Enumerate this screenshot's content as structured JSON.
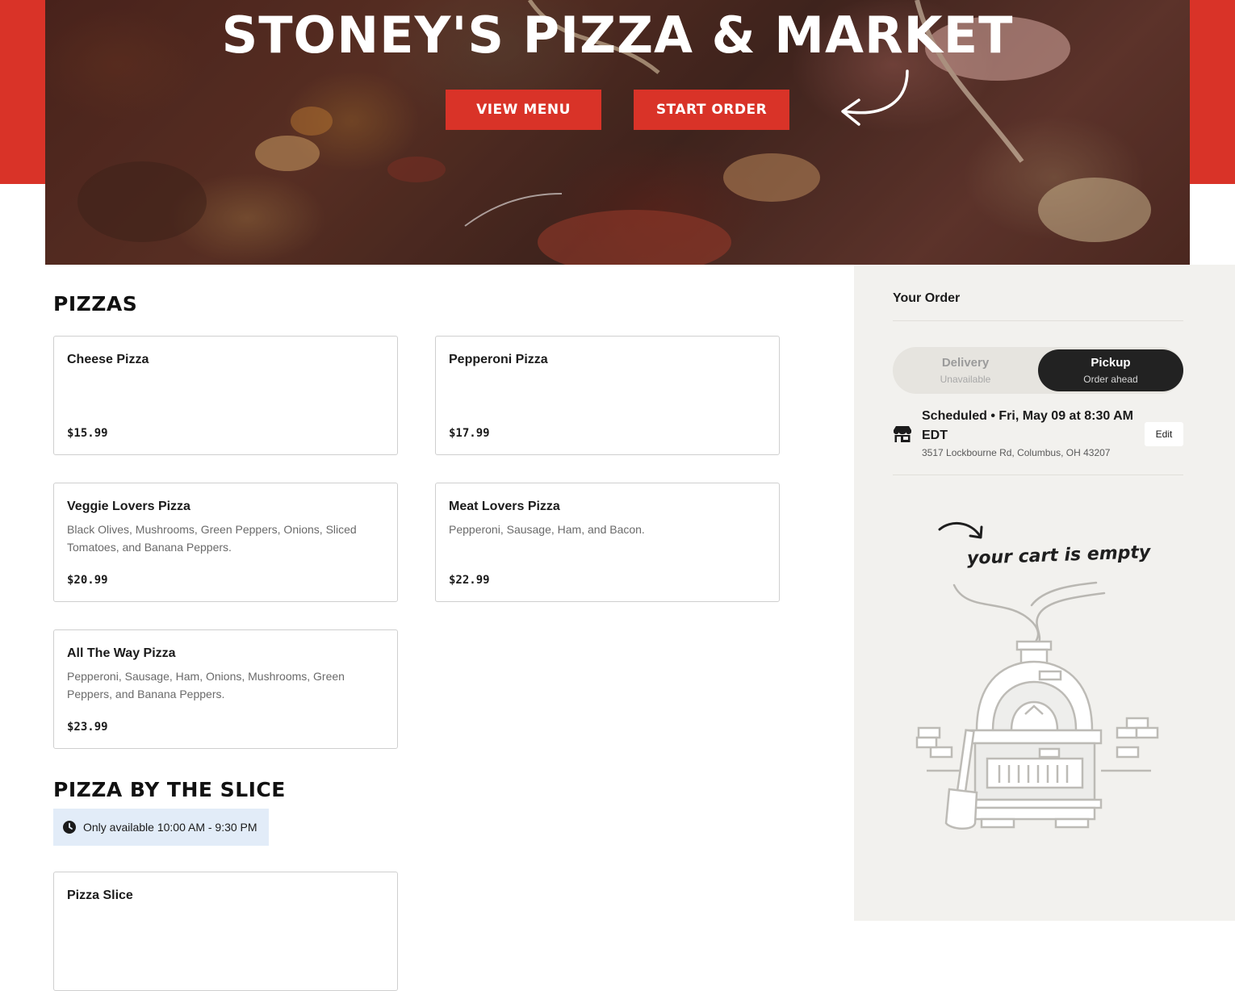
{
  "hero": {
    "title": "STONEY'S PIZZA & MARKET",
    "view_menu_label": "VIEW MENU",
    "start_order_label": "START ORDER"
  },
  "colors": {
    "brand_red": "#d93328",
    "dark_pill": "#222222",
    "sidebar_bg": "#f2f1ee",
    "availability_bg": "#e2ecf8"
  },
  "sections": {
    "pizzas": {
      "title": "PIZZAS",
      "items": [
        {
          "name": "Cheese Pizza",
          "description": "",
          "price": "$15.99"
        },
        {
          "name": "Pepperoni Pizza",
          "description": "",
          "price": "$17.99"
        },
        {
          "name": "Veggie Lovers Pizza",
          "description": "Black Olives, Mushrooms, Green Peppers, Onions, Sliced Tomatoes, and Banana Peppers.",
          "price": "$20.99"
        },
        {
          "name": "Meat Lovers Pizza",
          "description": "Pepperoni, Sausage, Ham, and Bacon.",
          "price": "$22.99"
        },
        {
          "name": "All The Way Pizza",
          "description": "Pepperoni, Sausage, Ham, Onions, Mushrooms, Green Peppers, and Banana Peppers.",
          "price": "$23.99"
        }
      ]
    },
    "slice": {
      "title": "PIZZA BY THE SLICE",
      "availability": "Only available 10:00 AM - 9:30 PM",
      "items": [
        {
          "name": "Pizza Slice"
        }
      ]
    }
  },
  "order": {
    "title": "Your Order",
    "delivery": {
      "label": "Delivery",
      "sub": "Unavailable"
    },
    "pickup": {
      "label": "Pickup",
      "sub": "Order ahead"
    },
    "schedule": "Scheduled • Fri, May 09 at 8:30 AM EDT",
    "address": "3517 Lockbourne Rd, Columbus, OH 43207",
    "edit_label": "Edit",
    "empty_text": "your cart is empty"
  },
  "icons": {
    "hero_arrow": "curved-arrow-icon",
    "clock": "clock-icon",
    "store": "store-icon",
    "empty_arrow": "curved-arrow-icon",
    "oven": "pizza-oven-illustration"
  }
}
